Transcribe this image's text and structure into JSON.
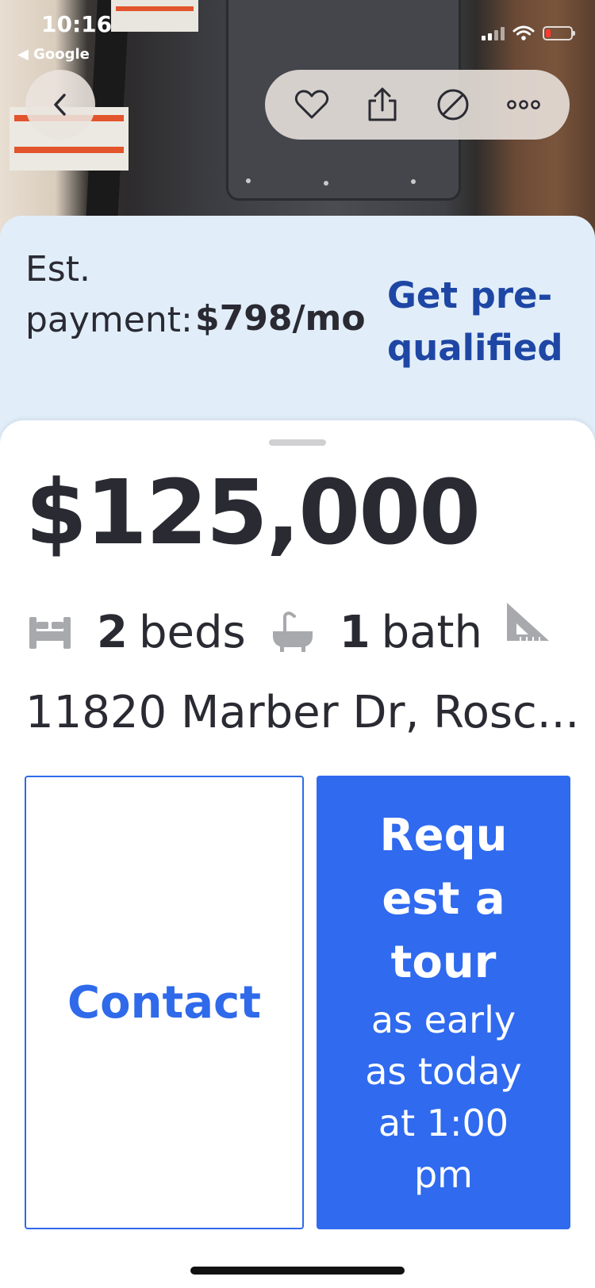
{
  "status_bar": {
    "time": "10:16",
    "back_app": "◀ Google",
    "battery_color": "#ff3b30"
  },
  "actions": {
    "back_icon": "chevron-left-icon",
    "favorite_icon": "heart-icon",
    "share_icon": "share-icon",
    "hide_icon": "hide-icon",
    "more_icon": "more-icon"
  },
  "payment": {
    "label": "Est. payment:",
    "amount": "$798/mo",
    "cta": "Get pre-qualified",
    "background": "#e1eefa",
    "accent": "#1e46a4"
  },
  "listing": {
    "price": "$125,000",
    "beds_count": "2",
    "beds_label": "beds",
    "baths_count": "1",
    "baths_label": "bath",
    "address": "11820 Marber Dr, Rosc..."
  },
  "buttons": {
    "contact": "Contact",
    "tour_title": "Request a tour",
    "tour_subtitle": "as early as today at 1:00 pm",
    "primary_color": "#2f6aef"
  }
}
